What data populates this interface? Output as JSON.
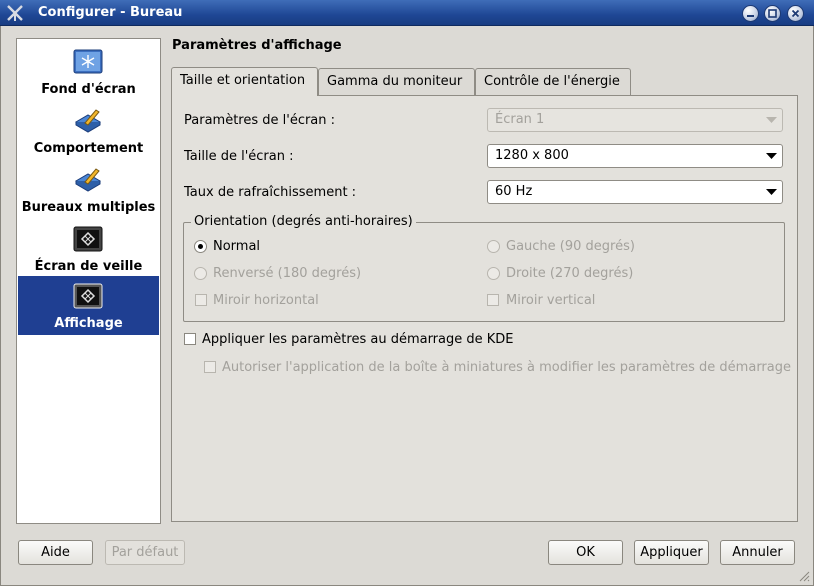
{
  "window": {
    "title": "Configurer - Bureau",
    "buttons": [
      "minimize-icon",
      "maximize-icon",
      "close-icon"
    ]
  },
  "sidebar": {
    "items": [
      {
        "label": "Fond d'écran",
        "icon": "wallpaper-icon",
        "selected": false
      },
      {
        "label": "Comportement",
        "icon": "behavior-icon",
        "selected": false
      },
      {
        "label": "Bureaux multiples",
        "icon": "multiple-desktops-icon",
        "selected": false
      },
      {
        "label": "Écran de veille",
        "icon": "screensaver-icon",
        "selected": false
      },
      {
        "label": "Affichage",
        "icon": "display-icon",
        "selected": true
      }
    ]
  },
  "main": {
    "title": "Paramètres d'affichage",
    "tabs": [
      {
        "label": "Taille et orientation",
        "active": true
      },
      {
        "label": "Gamma du moniteur",
        "active": false
      },
      {
        "label": "Contrôle de l'énergie",
        "active": false
      }
    ],
    "screen_settings": {
      "label": "Paramètres de l'écran :",
      "value": "Écran 1",
      "enabled": false
    },
    "screen_size": {
      "label": "Taille de l'écran :",
      "value": "1280 x 800"
    },
    "refresh_rate": {
      "label": "Taux de rafraîchissement :",
      "value": "60 Hz"
    },
    "orientation": {
      "title": "Orientation (degrés anti-horaires)",
      "normal": "Normal",
      "left": "Gauche (90 degrés)",
      "inverted": "Renversé (180 degrés)",
      "right": "Droite (270 degrés)",
      "mirror_h": "Miroir horizontal",
      "mirror_v": "Miroir vertical",
      "selected": "normal"
    },
    "apply_startup": {
      "label": "Appliquer les paramètres au démarrage de KDE",
      "checked": false
    },
    "allow_tray": {
      "label": "Autoriser l'application de la boîte à miniatures à modifier les paramètres de démarrage",
      "checked": false,
      "enabled": false
    }
  },
  "footer": {
    "help": "Aide",
    "defaults": "Par défaut",
    "ok": "OK",
    "apply": "Appliquer",
    "cancel": "Annuler"
  },
  "colors": {
    "titlebar": "#1f4795",
    "selection": "#1f3f92",
    "background": "#dcdad5"
  }
}
